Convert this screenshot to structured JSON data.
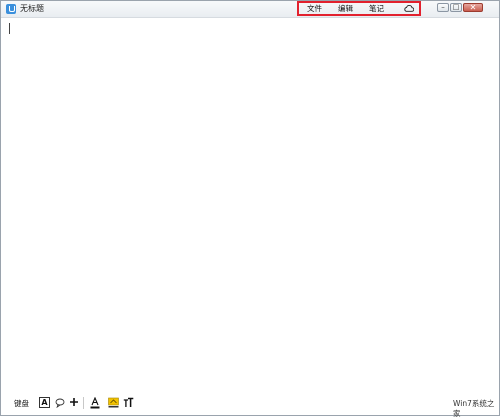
{
  "window": {
    "title": "无标题",
    "menu": {
      "file": "文件",
      "edit": "编辑",
      "notes": "笔记",
      "cloud_icon": "cloud-icon"
    },
    "controls": {
      "minimize_glyph": "–",
      "maximize_glyph": "□",
      "close_glyph": "✕"
    },
    "highlight_color": "#e2212e"
  },
  "toolbar": {
    "keyboard_label": "键盘",
    "font_button": "A",
    "status_text": "Win7系统之家"
  }
}
